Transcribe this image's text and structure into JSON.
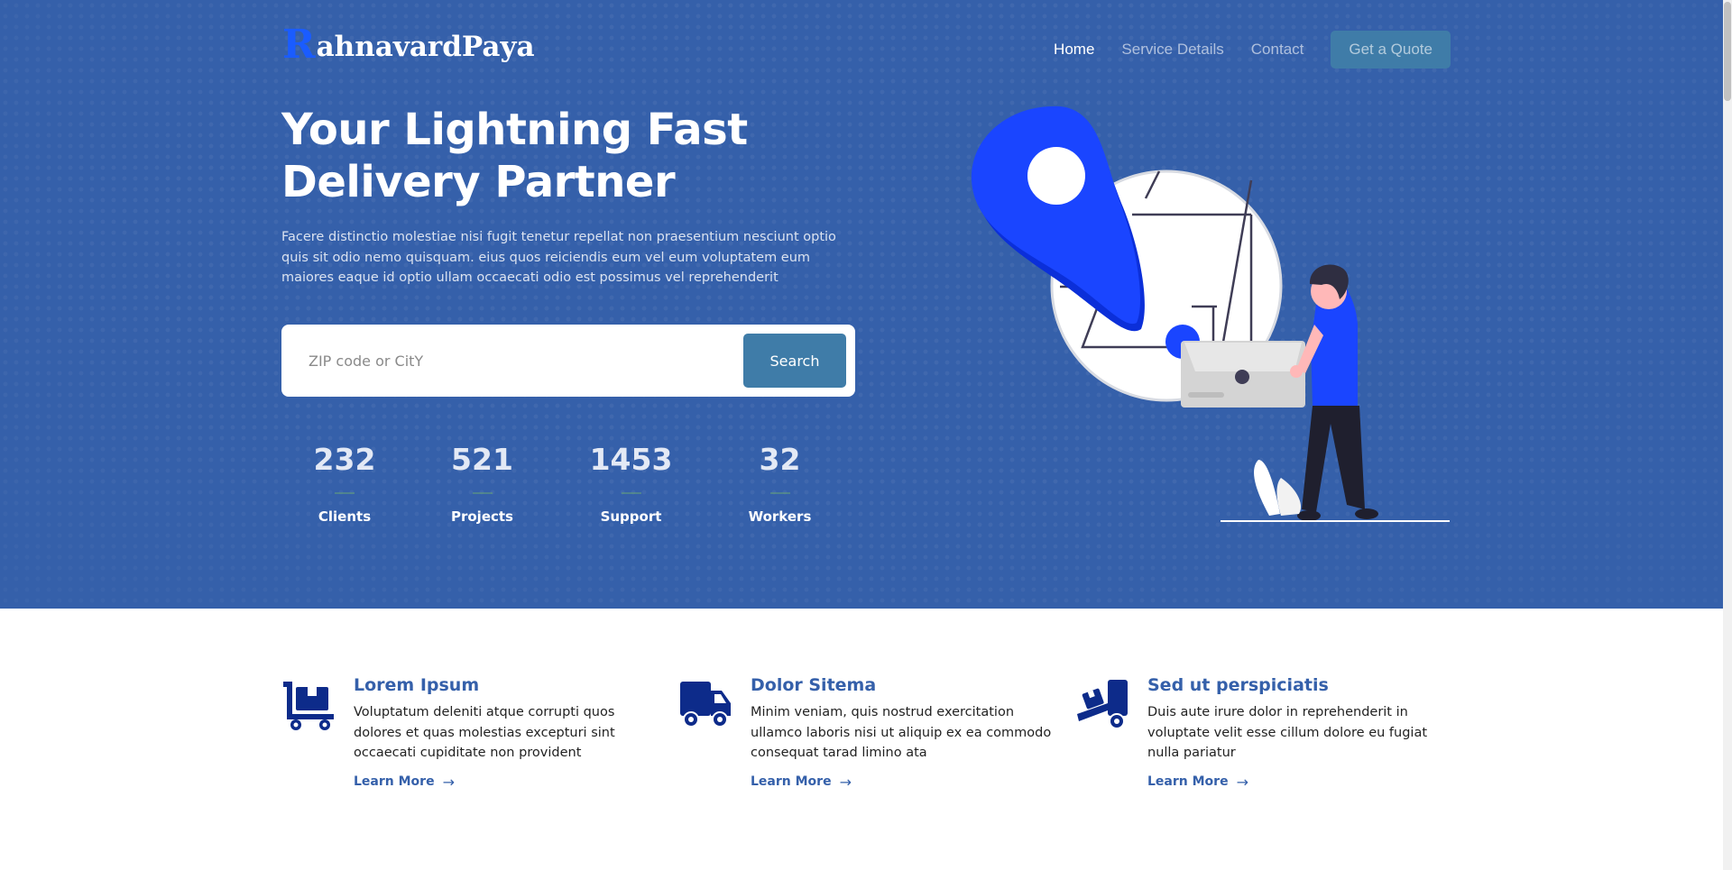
{
  "brand": {
    "initial": "R",
    "name": "ahnavardPaya"
  },
  "nav": {
    "items": [
      "Home",
      "Service Details",
      "Contact"
    ],
    "cta": "Get a Quote"
  },
  "hero": {
    "title": "Your Lightning Fast Delivery Partner",
    "description": "Facere distinctio molestiae nisi fugit tenetur repellat non praesentium nesciunt optio quis sit odio nemo quisquam. eius quos reiciendis eum vel eum voluptatem eum maiores eaque id optio ullam occaecati odio est possimus vel reprehenderit",
    "search": {
      "placeholder": "ZIP code or CitY",
      "button": "Search"
    },
    "stats": [
      {
        "value": "232",
        "label": "Clients"
      },
      {
        "value": "521",
        "label": "Projects"
      },
      {
        "value": "1453",
        "label": "Support"
      },
      {
        "value": "32",
        "label": "Workers"
      }
    ]
  },
  "features": [
    {
      "icon": "cart-flatbed-boxes-icon",
      "title": "Lorem Ipsum",
      "text": "Voluptatum deleniti atque corrupti quos dolores et quas molestias excepturi sint occaecati cupiditate non provident",
      "link": "Learn More"
    },
    {
      "icon": "truck-icon",
      "title": "Dolor Sitema",
      "text": "Minim veniam, quis nostrud exercitation ullamco laboris nisi ut aliquip ex ea commodo consequat tarad limino ata",
      "link": "Learn More"
    },
    {
      "icon": "truck-ramp-box-icon",
      "title": "Sed ut perspiciatis",
      "text": "Duis aute irure dolor in reprehenderit in voluptate velit esse cillum dolore eu fugiat nulla pariatur",
      "link": "Learn More"
    }
  ],
  "colors": {
    "hero_bg": "#3560aa",
    "accent_button": "#3f7ca8",
    "brand_blue": "#1a5cff",
    "feature_icon": "#0d2b8a"
  }
}
